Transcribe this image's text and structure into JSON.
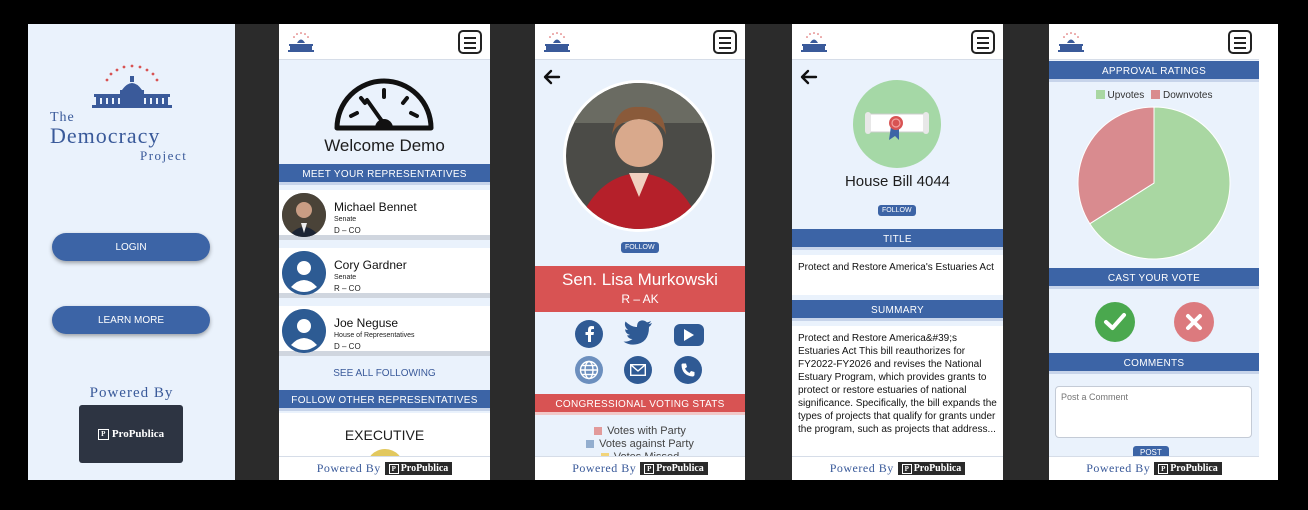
{
  "brand": {
    "the": "The",
    "main": "Democracy",
    "sub": "Project"
  },
  "login": {
    "login_label": "LOGIN",
    "learn_more_label": "LEARN MORE",
    "powered_by": "Powered By",
    "propublica": "ProPublica"
  },
  "footer": {
    "powered_by": "Powered By",
    "propublica": "ProPublica"
  },
  "home": {
    "welcome": "Welcome Demo",
    "meet_banner": "MEET YOUR REPRESENTATIVES",
    "reps": [
      {
        "name": "Michael Bennet",
        "role": "Senate",
        "party": "D – CO"
      },
      {
        "name": "Cory Gardner",
        "role": "Senate",
        "party": "R – CO"
      },
      {
        "name": "Joe Neguse",
        "role": "House of Representatives",
        "party": "D – CO"
      }
    ],
    "see_all": "SEE ALL FOLLOWING",
    "follow_other_banner": "FOLLOW OTHER REPRESENTATIVES",
    "executive": "EXECUTIVE"
  },
  "senator": {
    "follow": "FOLLOW",
    "name": "Sen. Lisa Murkowski",
    "party": "R – AK",
    "voting_stats_banner": "CONGRESSIONAL VOTING STATS",
    "legend": [
      "Votes with Party",
      "Votes against Party",
      "Votes Missed"
    ],
    "colors": {
      "with": "#e29a9a",
      "against": "#93aecf",
      "missed": "#f2d47a"
    }
  },
  "bill": {
    "title": "House Bill 4044",
    "follow": "FOLLOW",
    "title_banner": "TITLE",
    "title_text": "Protect and Restore America's Estuaries Act",
    "summary_banner": "SUMMARY",
    "summary_text": "Protect and Restore America&#39;s Estuaries Act This bill reauthorizes for FY2022-FY2026 and revises the National Estuary Program, which provides grants to protect or restore estuaries of national significance. Specifically, the bill expands the types of projects that qualify for grants under the program, such as projects that address..."
  },
  "approval": {
    "banner": "APPROVAL RATINGS",
    "legend_up": "Upvotes",
    "legend_down": "Downvotes",
    "cast_banner": "CAST YOUR VOTE",
    "comments_banner": "COMMENTS",
    "comment_placeholder": "Post a Comment",
    "post_label": "POST",
    "colors": {
      "up": "#a9d7a2",
      "down": "#d98b8f"
    }
  },
  "chart_data": {
    "type": "pie",
    "categories": [
      "Upvotes",
      "Downvotes"
    ],
    "values": [
      66,
      34
    ]
  }
}
